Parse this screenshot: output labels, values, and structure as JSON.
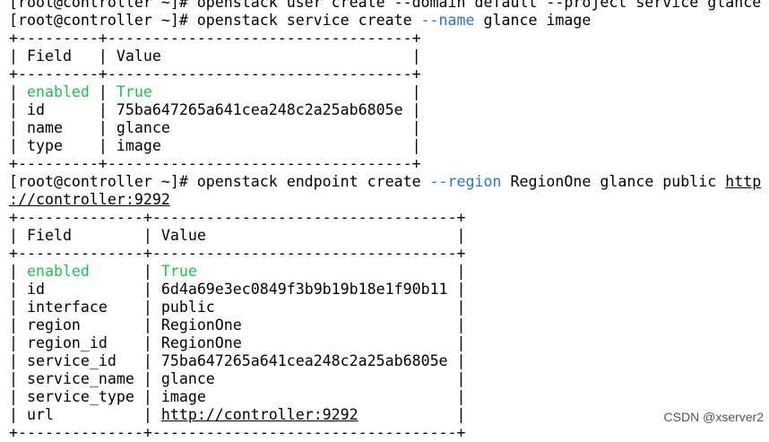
{
  "terminal": {
    "partial_top_line": "[root@controller ~]# openstack user create --domain default --project service glance",
    "cmd1": {
      "prompt": "[root@controller ~]# ",
      "command": "openstack service create ",
      "flag": "--name",
      "args": " glance image"
    },
    "table1": {
      "border_top": "+---------+----------------------------------+",
      "header": {
        "field": "Field",
        "value": "Value"
      },
      "rows": [
        {
          "field": "enabled",
          "value": "True",
          "highlight": true
        },
        {
          "field": "id",
          "value": "75ba647265a641cea248c2a25ab6805e"
        },
        {
          "field": "name",
          "value": "glance"
        },
        {
          "field": "type",
          "value": "image"
        }
      ]
    },
    "cmd2": {
      "prompt": "[root@controller ~]# ",
      "command": "openstack endpoint create ",
      "flag": "--region",
      "args": " RegionOne glance public ",
      "url_part1": "http",
      "url_part2": "://controller:9292"
    },
    "table2": {
      "border_top": "+--------------+----------------------------------+",
      "header": {
        "field": "Field",
        "value": "Value"
      },
      "rows": [
        {
          "field": "enabled",
          "value": "True",
          "highlight": true
        },
        {
          "field": "id",
          "value": "6d4a69e3ec0849f3b9b19b18e1f90b11"
        },
        {
          "field": "interface",
          "value": "public"
        },
        {
          "field": "region",
          "value": "RegionOne"
        },
        {
          "field": "region_id",
          "value": "RegionOne"
        },
        {
          "field": "service_id",
          "value": "75ba647265a641cea248c2a25ab6805e"
        },
        {
          "field": "service_name",
          "value": "glance"
        },
        {
          "field": "service_type",
          "value": "image"
        },
        {
          "field": "url",
          "value": "http://controller:9292",
          "link": true
        }
      ]
    }
  },
  "watermark": "CSDN @xserver2",
  "colors": {
    "flag": "#2f6fd6",
    "enabled_value": "#1fbf52",
    "background": "#ffffff",
    "text": "#000000"
  }
}
